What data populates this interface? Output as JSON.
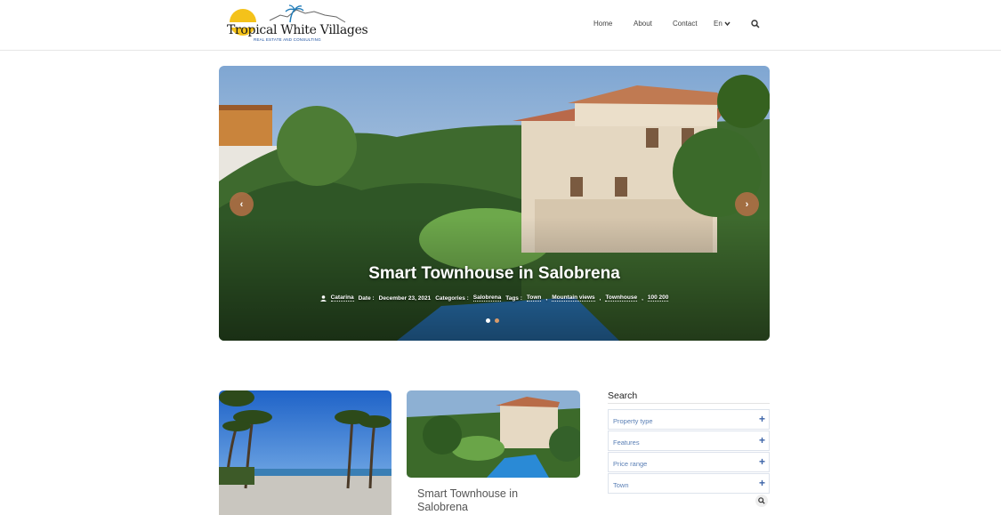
{
  "header": {
    "logo_title": "Tropical White Villages",
    "logo_subtitle": "REAL ESTATE AND CONSULTING",
    "nav": {
      "home": "Home",
      "about": "About",
      "contact": "Contact",
      "language": "En"
    }
  },
  "slider": {
    "title": "Smart Townhouse in Salobrena",
    "author": "Catarina",
    "date_label": "Date :",
    "date": "December 23, 2021",
    "categories_label": "Categories :",
    "category": "Salobrena",
    "tags_label": "Tags :",
    "tags": [
      "Town",
      "Mountain views",
      "Townhouse",
      "100 200"
    ],
    "prev_arrow": "‹",
    "next_arrow": "›",
    "slide_count": 2,
    "active_slide": 1
  },
  "cards": [
    {
      "title": ""
    },
    {
      "title": "Smart Townhouse in Salobrena"
    }
  ],
  "search": {
    "heading": "Search",
    "filters": [
      "Property type",
      "Features",
      "Price range",
      "Town"
    ],
    "plus": "+"
  },
  "colors": {
    "accent": "#c07a4e",
    "link_blue": "#5a7fb5",
    "plus_blue": "#3d64a8"
  }
}
